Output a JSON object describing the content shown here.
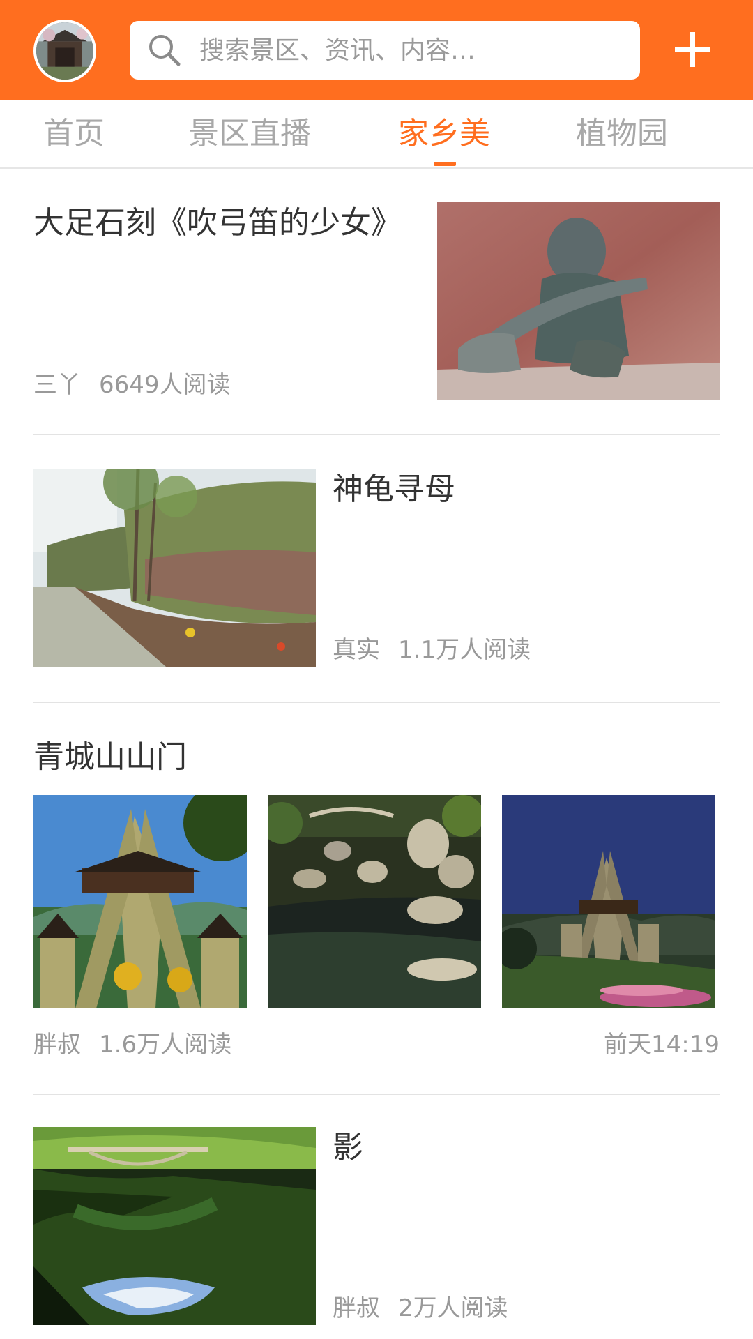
{
  "header": {
    "search_placeholder": "搜索景区、资讯、内容…",
    "accent_color": "#ff6e1f",
    "avatar_icon": "user-avatar",
    "search_icon": "search-icon",
    "add_icon": "plus-icon"
  },
  "tabs": [
    {
      "label": "首页",
      "active": false
    },
    {
      "label": "景区直播",
      "active": false
    },
    {
      "label": "家乡美",
      "active": true
    },
    {
      "label": "植物园",
      "active": false
    }
  ],
  "articles": [
    {
      "title": "大足石刻《吹弓笛的少女》",
      "author": "三丫",
      "reads": "6649人阅读",
      "image": "stone-carving-photo"
    },
    {
      "title": "神龟寻母",
      "author": "真实",
      "reads": "1.1万人阅读",
      "image": "mossy-rock-photo"
    },
    {
      "title": "青城山山门",
      "author": "胖叔",
      "reads": "1.6万人阅读",
      "time": "前天14:19",
      "images": [
        "mountain-gate-photo",
        "stream-rocks-photo",
        "gate-dusk-photo"
      ]
    },
    {
      "title": "影",
      "author": "胖叔",
      "reads": "2万人阅读",
      "image": "bridge-reflection-photo"
    }
  ]
}
